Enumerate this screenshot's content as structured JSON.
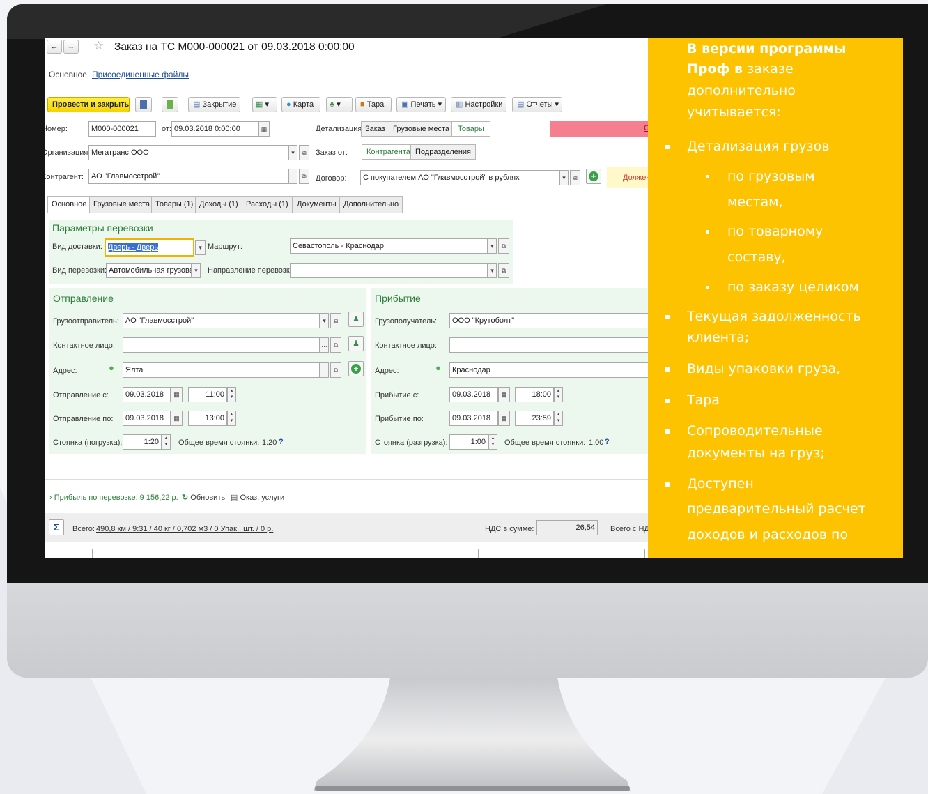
{
  "window": {
    "title": "Заказ на ТС М000-000021 от 09.03.2018 0:00:00",
    "nav_back": "←",
    "nav_forward": "→",
    "star": "☆"
  },
  "top_tabs": [
    "Основное",
    "Присоединенные файлы"
  ],
  "toolbar": {
    "post_close": "Провести и закрыть",
    "closing": "Закрытие",
    "map": "Карта",
    "tara": "Тара",
    "print": "Печать",
    "settings": "Настройки",
    "reports": "Отчеты"
  },
  "header": {
    "number_label": "Номер:",
    "number_value": "М000-000021",
    "date_label": "от:",
    "date_value": "09.03.2018  0:00:00",
    "detail_label": "Детализация:",
    "detail_options": [
      "Заказ",
      "Грузовые места",
      "Товары"
    ],
    "org_label": "Организация:",
    "org_value": "Мегатранс ООО",
    "order_from_label": "Заказ от:",
    "order_from_options": [
      "Контрагента",
      "Подразделения"
    ],
    "counterparty_label": "Контрагент:",
    "counterparty_value": "АО \"Главмосстрой\"",
    "contract_label": "Договор:",
    "contract_value": "С покупателем АО \"Главмосстрой\" в рублях",
    "debt_link": "Должен",
    "red_link": "С"
  },
  "tabs": [
    "Основное",
    "Грузовые места",
    "Товары (1)",
    "Доходы (1)",
    "Расходы (1)",
    "Документы",
    "Дополнительно"
  ],
  "params": {
    "heading": "Параметры перевозки",
    "delivery_label": "Вид доставки:",
    "delivery_value": "Дверь - Дверь",
    "route_label": "Маршрут:",
    "route_value": "Севастополь - Краснодар",
    "transport_label": "Вид перевозки:",
    "transport_value": "Автомобильная грузовая",
    "direction_label": "Направление перевозки:",
    "direction_value": ""
  },
  "departure": {
    "heading": "Отправление",
    "shipper_label": "Грузоотправитель:",
    "shipper_value": "АО \"Главмосстрой\"",
    "contact_label": "Контактное лицо:",
    "contact_value": "",
    "address_label": "Адрес:",
    "address_value": "Ялта",
    "from_label": "Отправление с:",
    "from_date": "09.03.2018",
    "from_time": "11:00",
    "to_label": "Отправление по:",
    "to_date": "09.03.2018",
    "to_time": "13:00",
    "stop_label": "Стоянка (погрузка):",
    "stop_value": "1:20",
    "total_stop_label": "Общее время стоянки:",
    "total_stop_value": "1:20",
    "help": "?"
  },
  "arrival": {
    "heading": "Прибытие",
    "consignee_label": "Грузополучатель:",
    "consignee_value": "ООО \"Крутоболт\"",
    "contact_label": "Контактное лицо:",
    "contact_value": "",
    "address_label": "Адрес:",
    "address_value": "Краснодар",
    "from_label": "Прибытие с:",
    "from_date": "09.03.2018",
    "from_time": "18:00",
    "to_label": "Прибытие по:",
    "to_date": "09.03.2018",
    "to_time": "23:59",
    "stop_label": "Стоянка (разгрузка):",
    "stop_value": "1:00",
    "total_stop_label": "Общее время стоянки:",
    "total_stop_value": "1:00",
    "help": "?"
  },
  "profit": {
    "text": "Прибыль по перевозке: 9 156,22 р.",
    "refresh": "Обновить",
    "services": "Оказ. услуги"
  },
  "totals": {
    "sigma": "Σ",
    "label": "Всего:",
    "value": "490,8 км / 9:31 / 40 кг / 0,702 м3 / 0 Упак., шт. / 0 р.",
    "vat_label": "НДС в сумме:",
    "vat_value": "26,54",
    "total_vat_label": "Всего с НД"
  },
  "panel": {
    "intro_bold": "В версии программы",
    "intro_bold2": "Проф в",
    "intro_rest": " заказе",
    "intro_line3": "дополнительно",
    "intro_line4": "учитывается:",
    "items": [
      "Детализация грузов",
      "по грузовым",
      "местам,",
      "по товарному",
      "составу,",
      "по заказу целиком",
      "Текущая задолженность",
      "клиента;",
      "Виды упаковки груза,",
      "Тара",
      "Сопроводительные",
      "документы на груз;",
      "Доступен",
      "предварительный расчет",
      "доходов и расходов по"
    ]
  },
  "colors": {
    "panel_bg": "#fdc200",
    "accent_yellow": "#f5d400",
    "section_green": "#ecf7ee",
    "heading_green": "#2d7e3a",
    "alert_pink": "#f57f8f"
  }
}
